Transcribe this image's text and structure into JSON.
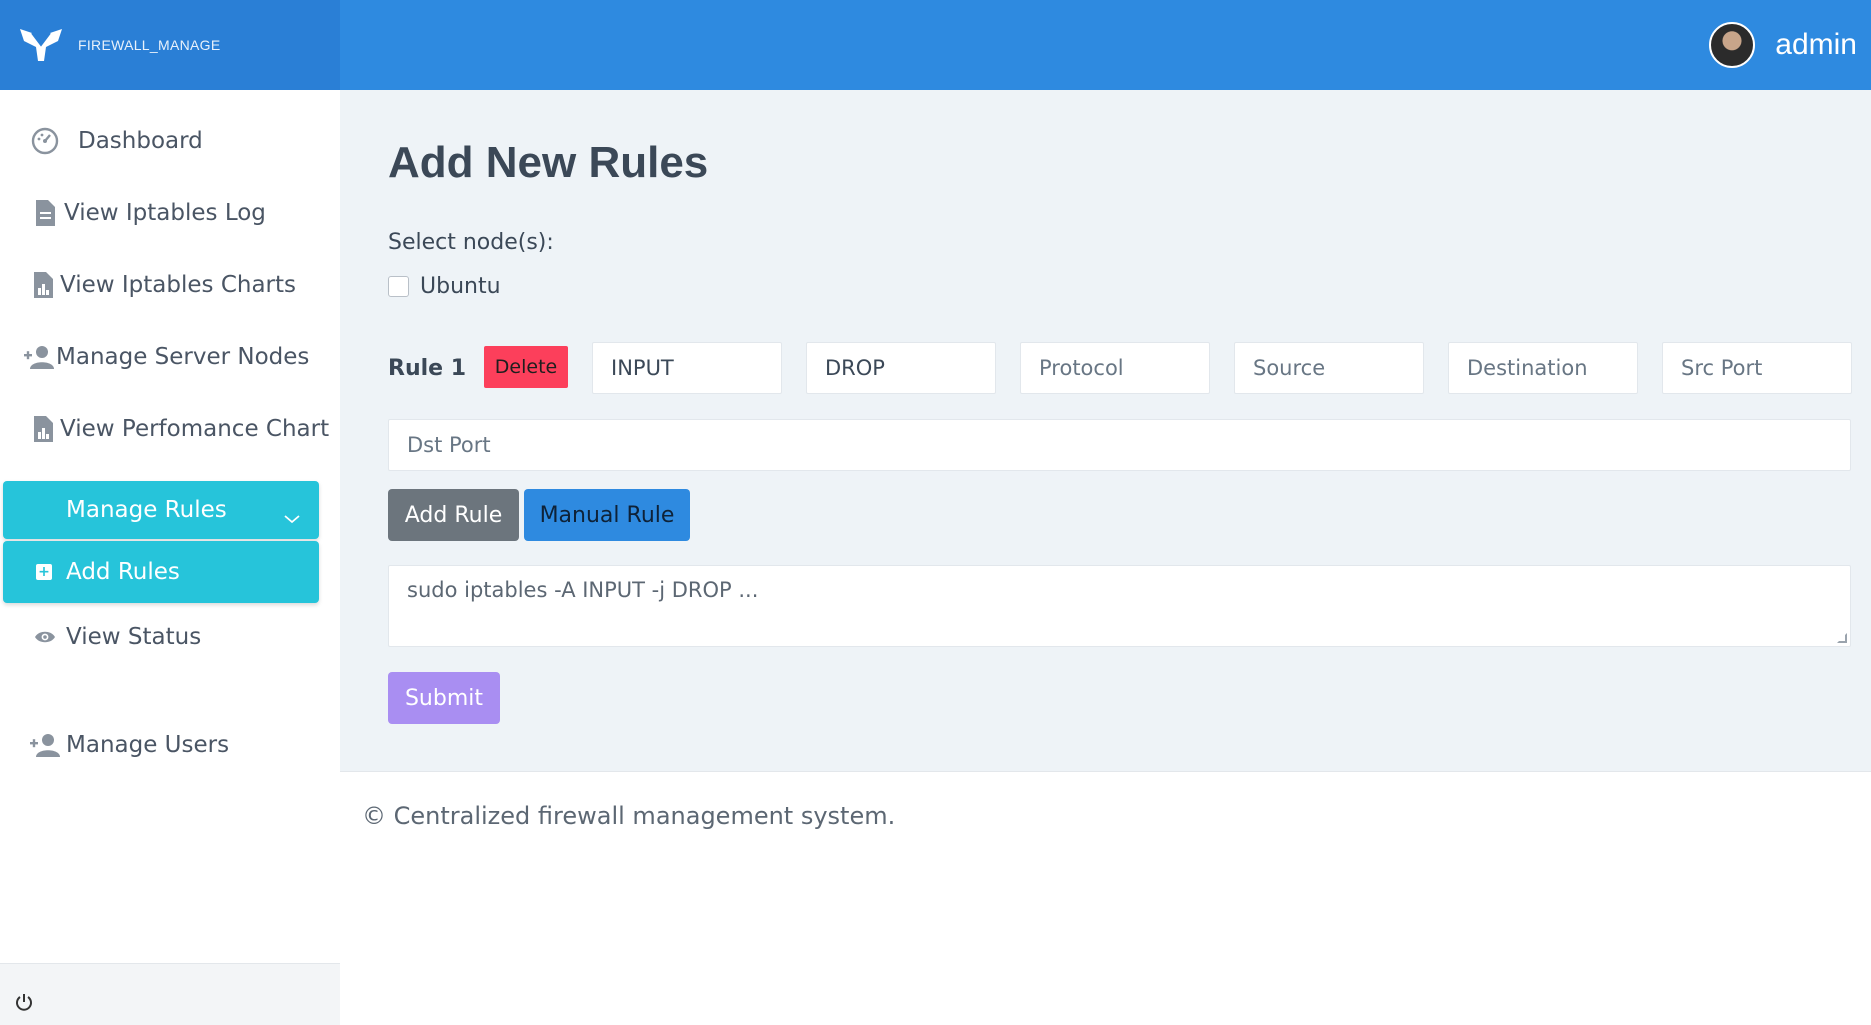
{
  "brand": {
    "name": "FIREWALL_MANAGE"
  },
  "user": {
    "name": "admin"
  },
  "sidebar": {
    "items": [
      {
        "label": "Dashboard",
        "icon": "speedometer-icon"
      },
      {
        "label": "View Iptables Log",
        "icon": "document-icon"
      },
      {
        "label": "View Iptables Charts",
        "icon": "chart-file-icon"
      },
      {
        "label": "Manage Server Nodes",
        "icon": "add-user-icon"
      },
      {
        "label": "View Perfomance Chart",
        "icon": "chart-file-icon"
      },
      {
        "label": "View Status",
        "icon": "eye-icon"
      },
      {
        "label": "Manage Users",
        "icon": "add-user-icon"
      }
    ],
    "group": {
      "label": "Manage Rules",
      "sub_label": "Add Rules"
    }
  },
  "main": {
    "title": "Add New Rules",
    "select_label": "Select node(s):",
    "nodes": [
      {
        "label": "Ubuntu",
        "checked": false
      }
    ],
    "rule": {
      "label": "Rule 1",
      "delete_label": "Delete",
      "chain_value": "INPUT",
      "target_value": "DROP",
      "protocol_placeholder": "Protocol",
      "source_placeholder": "Source",
      "destination_placeholder": "Destination",
      "src_port_placeholder": "Src Port",
      "dst_port_placeholder": "Dst Port"
    },
    "add_rule_label": "Add Rule",
    "manual_rule_label": "Manual Rule",
    "manual_placeholder": "sudo iptables -A INPUT -j DROP ...",
    "submit_label": "Submit"
  },
  "footer": {
    "text": "© Centralized firewall management system."
  },
  "colors": {
    "primary": "#2e8ae0",
    "accent": "#26c4da",
    "danger": "#fc3f5b",
    "submit": "#a98ef2",
    "secondary": "#6c757d"
  }
}
